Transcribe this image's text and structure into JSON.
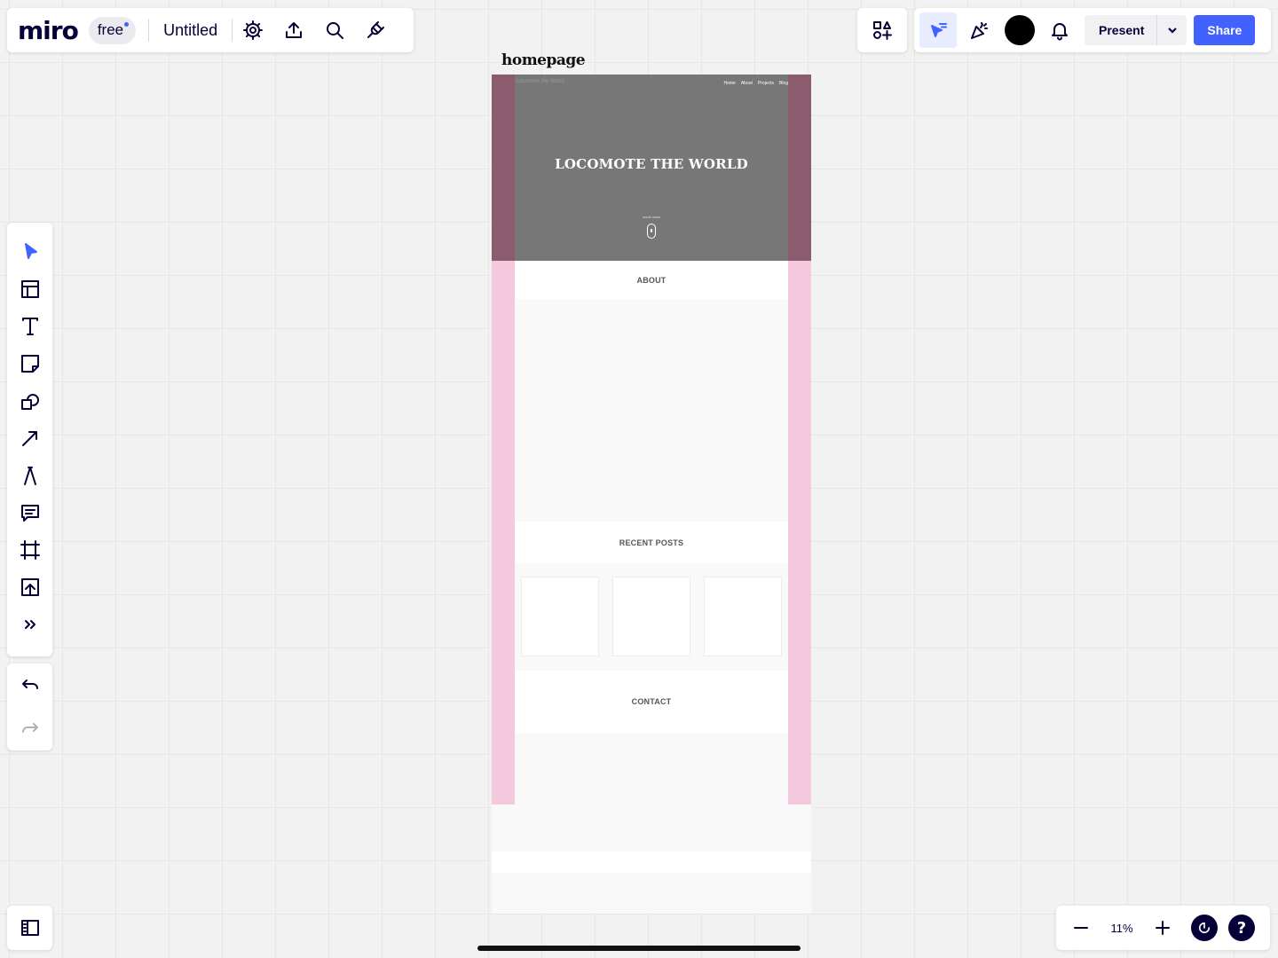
{
  "app": {
    "logo": "miro",
    "plan_badge": "free",
    "board_title": "Untitled"
  },
  "header": {
    "present_label": "Present",
    "share_label": "Share",
    "accent_color": "#4262ff"
  },
  "zoom": {
    "level": "11%"
  },
  "help": {
    "label": "?"
  },
  "toolbar": {
    "tools": [
      "select",
      "templates",
      "text",
      "sticky-note",
      "shapes",
      "line-arrow",
      "pen",
      "comment",
      "frame",
      "upload",
      "more"
    ]
  },
  "frame": {
    "title": "homepage",
    "hero": {
      "brand": "Locomote the World",
      "nav": [
        "Home",
        "About",
        "Projects",
        "Blog"
      ],
      "heading": "LOCOMOTE THE WORLD",
      "scroll_hint": "scroll down"
    },
    "sections": {
      "about": "ABOUT",
      "recent_posts": "RECENT POSTS",
      "contact": "CONTACT"
    }
  }
}
